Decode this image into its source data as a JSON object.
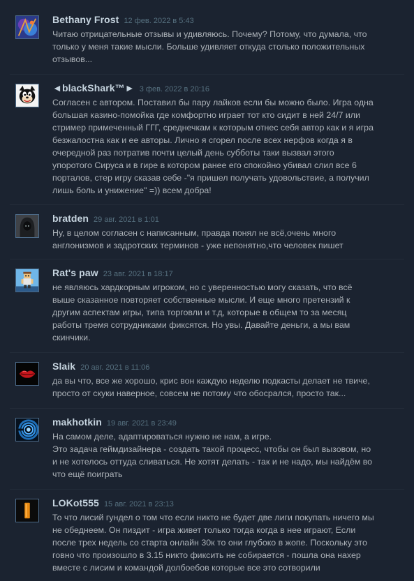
{
  "comments": [
    {
      "author": "Bethany Frost",
      "timestamp": "12 фев. 2022 в 5:43",
      "text": "Читаю отрицательные отзывы и удивляюсь. Почему? Потому, что думала, что\nтолько у меня такие мысли. Больше удивляет откуда столько положительных\nотзывов...",
      "avatar": "blue-purple-abstract-avatar-icon"
    },
    {
      "author": "◄blackShark™►",
      "timestamp": "3 фев. 2022 в 20:16",
      "text": "Согласен с автором. Поставил бы пару лайков если бы можно было. Игра одна\nбольшая казино-помойка где комфортно играет тот кто сидит в ней 24/7 или\nстример примеченный ГГГ, среднечкам к которым отнес себя автор как и я игра\nбезжалостна как и ее авторы. Лично я сгорел после всех нерфов когда я в\nочередной раз потратив почти целый день субботы таки вызвал этого\nупоротого Сируса и в гире в котором ранее его спокойно убивал слил все 6\nпорталов, стер игру сказав себе -\"я пришел получать удовольствие, а получил\nлишь боль и унижение\" =)) всем добра!",
      "avatar": "cartoon-cat-avatar-icon"
    },
    {
      "author": "bratden",
      "timestamp": "29 авг. 2021 в 1:01",
      "text": "Ну, в целом согласен с написанным, правда понял не всё,очень много\nанглонизмов и задротских терминов - уже непонятно,что человек пишет",
      "avatar": "hooded-figure-avatar-icon"
    },
    {
      "author": "Rat's paw",
      "timestamp": "23 авг. 2021 в 18:17",
      "text": "не являюсь хардкорным игроком, но с уверенностью могу сказать, что всё\nвыше сказанное повторяет собственные мысли. И еще много претензий к\nдругим аспектам игры, типа торговли и т.д, которые в общем то за месяц\nработы тремя сотрудниками фиксятся. Но увы. Давайте деньги, а мы вам\nскинчики.",
      "avatar": "pixel-character-avatar-icon"
    },
    {
      "author": "Slaik",
      "timestamp": "20 авг. 2021 в 11:06",
      "text": "да вы что, все же хорошо, крис вон каждую неделю подкасты делает не твиче,\nпросто от скуки наверное, совсем не потому что обосрался, просто так...",
      "avatar": "red-lips-avatar-icon"
    },
    {
      "author": "makhotkin",
      "timestamp": "19 авг. 2021 в 23:49",
      "text": "На самом деле, адаптироваться нужно не нам, а игре.\nЭто задача геймдизайнера - создать такой процесс, чтобы он был вызовом, но\nи не хотелось оттуда сливаться. Не хотят делать - так и не надо, мы найдём во\nчто ещё поиграть",
      "avatar": "blue-spiral-avatar-icon"
    },
    {
      "author": "LOKot555",
      "timestamp": "15 авг. 2021 в 23:13",
      "text": "То что лисий гундел о том что если никто не будет две лиги покупать ничего мы\nне обеднеем. Он пиздит - игра живет только тогда когда в нее играют, Если\nпосле трех недель со старта онлайн 30к то они глубоко в жопе. Поскольку это\nговно что произошло в 3.15 никто фиксить не собирается - пошла она нахер\nвместе с лисим и командой долбоебов которые все это сотворили",
      "avatar": "orange-bar-avatar-icon"
    }
  ]
}
